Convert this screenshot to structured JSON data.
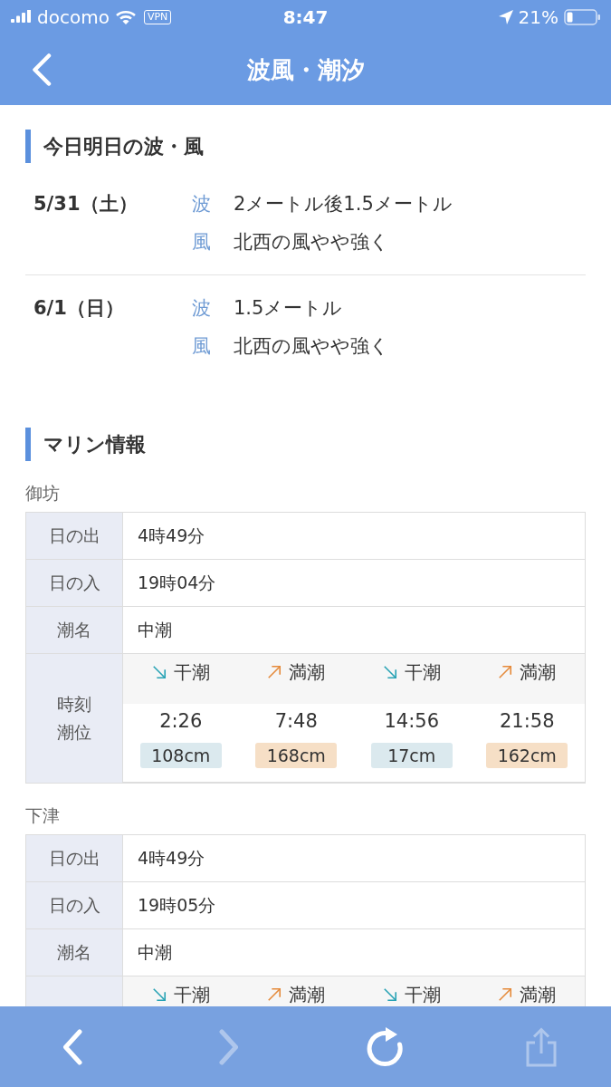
{
  "status_bar": {
    "carrier": "docomo",
    "vpn": "VPN",
    "time": "8:47",
    "battery": "21%"
  },
  "nav": {
    "title": "波風・潮汐"
  },
  "forecast": {
    "heading": "今日明日の波・風",
    "days": [
      {
        "date": "5/31（土）",
        "items": [
          {
            "label": "波",
            "value": "2メートル後1.5メートル"
          },
          {
            "label": "風",
            "value": "北西の風やや強く"
          }
        ]
      },
      {
        "date": "6/1（日）",
        "items": [
          {
            "label": "波",
            "value": "1.5メートル"
          },
          {
            "label": "風",
            "value": "北西の風やや強く"
          }
        ]
      }
    ]
  },
  "marine": {
    "heading": "マリン情報",
    "locations": [
      {
        "name": "御坊",
        "rows": [
          {
            "kind": "text",
            "label": "日の出",
            "value": "4時49分"
          },
          {
            "kind": "text",
            "label": "日の入",
            "value": "19時04分"
          },
          {
            "kind": "text",
            "label": "潮名",
            "value": "中潮"
          },
          {
            "kind": "tide",
            "label_lines": [
              "時刻",
              "潮位"
            ],
            "tides": [
              {
                "kind": "low",
                "name": "干潮",
                "time": "2:26",
                "height": "108cm"
              },
              {
                "kind": "high",
                "name": "満潮",
                "time": "7:48",
                "height": "168cm"
              },
              {
                "kind": "low",
                "name": "干潮",
                "time": "14:56",
                "height": "17cm"
              },
              {
                "kind": "high",
                "name": "満潮",
                "time": "21:58",
                "height": "162cm"
              }
            ]
          }
        ]
      },
      {
        "name": "下津",
        "rows": [
          {
            "kind": "text",
            "label": "日の出",
            "value": "4時49分"
          },
          {
            "kind": "text",
            "label": "日の入",
            "value": "19時05分"
          },
          {
            "kind": "text",
            "label": "潮名",
            "value": "中潮"
          },
          {
            "kind": "tide",
            "tides": [
              {
                "kind": "low",
                "name": "干潮"
              },
              {
                "kind": "high",
                "name": "満潮"
              },
              {
                "kind": "low",
                "name": "干潮"
              },
              {
                "kind": "high",
                "name": "満潮"
              }
            ]
          }
        ]
      }
    ]
  },
  "toolbar": {
    "buttons": [
      {
        "kind": "back",
        "disabled": false
      },
      {
        "kind": "forward",
        "disabled": true
      },
      {
        "kind": "reload",
        "disabled": false
      },
      {
        "kind": "share",
        "disabled": true
      }
    ]
  }
}
